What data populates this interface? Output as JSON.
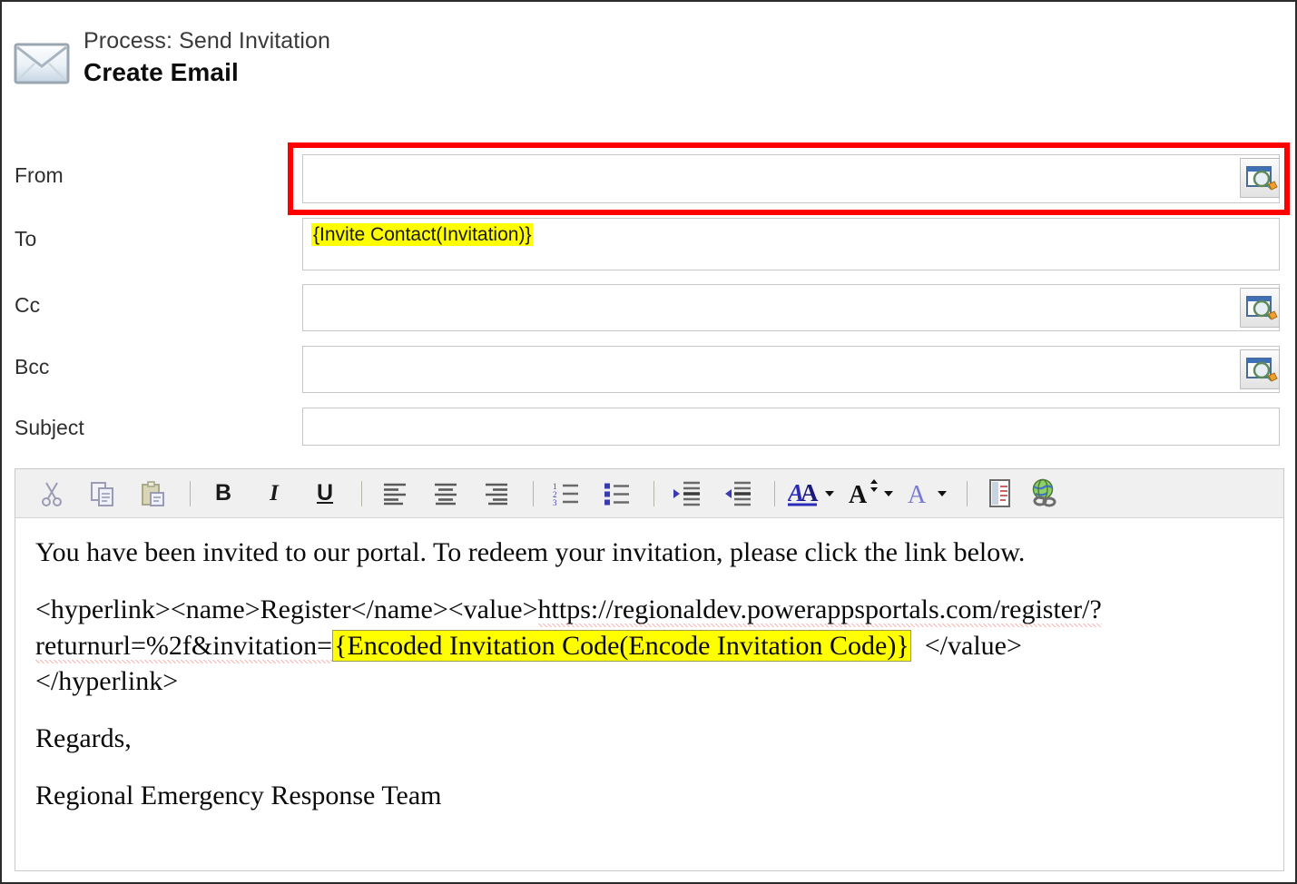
{
  "header": {
    "process_label": "Process: Send Invitation",
    "title": "Create Email",
    "icon": "envelope-icon"
  },
  "form": {
    "rows": [
      {
        "label": "From",
        "value": "",
        "has_lookup": true,
        "highlighted": false
      },
      {
        "label": "To",
        "value": "{Invite Contact(Invitation)}",
        "has_lookup": false,
        "highlighted": true
      },
      {
        "label": "Cc",
        "value": "",
        "has_lookup": true,
        "highlighted": false
      },
      {
        "label": "Bcc",
        "value": "",
        "has_lookup": true,
        "highlighted": false
      },
      {
        "label": "Subject",
        "value": "",
        "has_lookup": false,
        "highlighted": false
      }
    ],
    "lookup_icon": "lookup-dialog-icon",
    "annotation_color": "#ff0000",
    "highlight_color": "#ffff00"
  },
  "toolbar": {
    "buttons": [
      {
        "name": "cut-icon",
        "label": "Cut"
      },
      {
        "name": "copy-icon",
        "label": "Copy"
      },
      {
        "name": "paste-icon",
        "label": "Paste"
      },
      {
        "name": "bold-icon",
        "label": "B"
      },
      {
        "name": "italic-icon",
        "label": "I"
      },
      {
        "name": "underline-icon",
        "label": "U"
      },
      {
        "name": "align-left-icon",
        "label": "Align Left"
      },
      {
        "name": "align-center-icon",
        "label": "Align Center"
      },
      {
        "name": "align-right-icon",
        "label": "Align Right"
      },
      {
        "name": "numbered-list-icon",
        "label": "Numbered List"
      },
      {
        "name": "bulleted-list-icon",
        "label": "Bulleted List"
      },
      {
        "name": "increase-indent-icon",
        "label": "Increase Indent"
      },
      {
        "name": "decrease-indent-icon",
        "label": "Decrease Indent"
      },
      {
        "name": "font-name-icon",
        "label": "Font"
      },
      {
        "name": "font-size-icon",
        "label": "Font Size"
      },
      {
        "name": "font-color-icon",
        "label": "Font Color"
      },
      {
        "name": "source-document-icon",
        "label": "Source"
      },
      {
        "name": "insert-hyperlink-icon",
        "label": "Insert Hyperlink"
      }
    ]
  },
  "body": {
    "line1": "You have been invited to our portal. To redeem your invitation, please click the link below.",
    "link_open": "<hyperlink><name>Register</name><value>",
    "url_part1": "https://regionaldev.powerappsportals.com/register/?",
    "url_part2": "returnurl=%2f&invitation=",
    "token": "{Encoded Invitation Code(Encode Invitation Code)}",
    "value_close": "</value>",
    "link_close": "</hyperlink>",
    "regards": "Regards,",
    "signature": "Regional Emergency Response Team"
  }
}
